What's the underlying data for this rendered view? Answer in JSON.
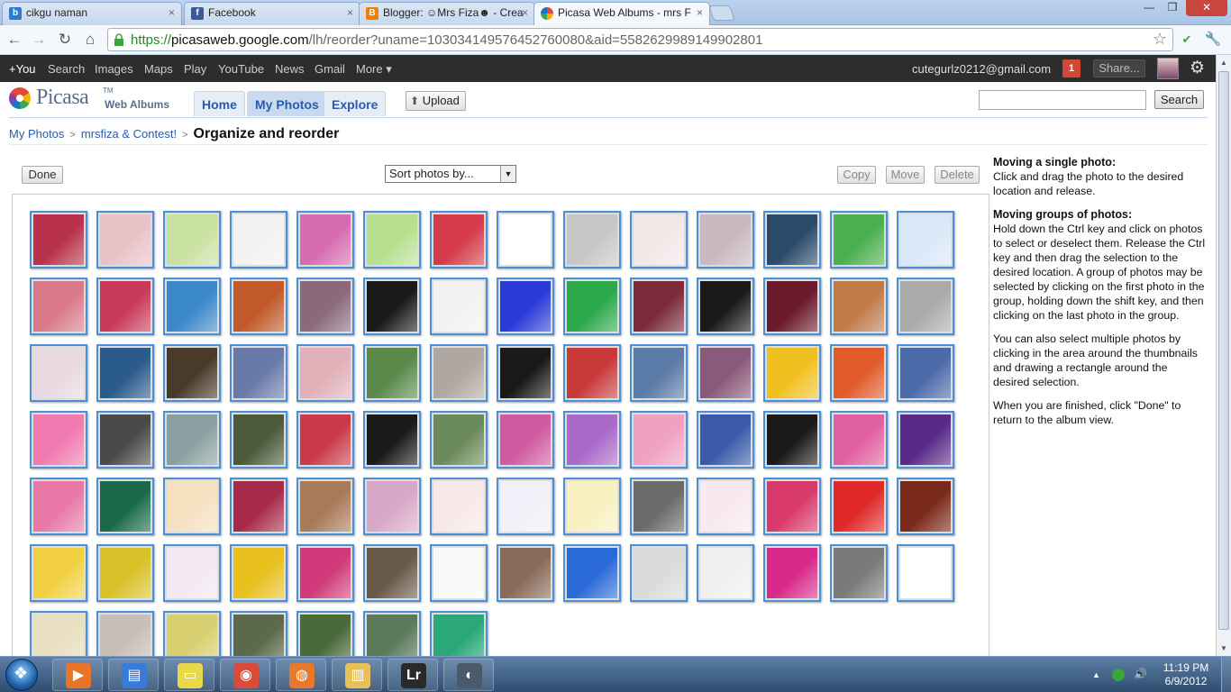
{
  "browser": {
    "tabs": [
      {
        "label": "cikgu naman",
        "active": false,
        "color": "#2d7bd1"
      },
      {
        "label": "Facebook",
        "active": false,
        "color": "#3b5998"
      },
      {
        "label": "Blogger: ☺Mrs Fiza☻ - Crea",
        "active": false,
        "color": "#f57d00"
      },
      {
        "label": "Picasa Web Albums - mrs F",
        "active": true,
        "color": "#9c4ea6"
      }
    ],
    "tab_close": "×",
    "window": {
      "minimize": "—",
      "maximize": "❐",
      "close": "✕"
    },
    "nav": {
      "back": "←",
      "forward": "→",
      "reload": "↻",
      "home": "⌂",
      "wrench": "🔧"
    },
    "url_scheme": "https://",
    "url_host": "picasaweb.google.com",
    "url_path": "/lh/reorder?uname=103034149576452760080&aid=5582629989149902801",
    "star": "☆"
  },
  "gbar": {
    "items": [
      "+You",
      "Search",
      "Images",
      "Maps",
      "Play",
      "YouTube",
      "News",
      "Gmail",
      "More ▾"
    ],
    "email": "cutegurlz0212@gmail.com",
    "notification_count": "1",
    "share_label": "Share...",
    "gear": "⚙"
  },
  "header": {
    "logo_name": "Picasa",
    "logo_tm": "TM",
    "logo_sub": "Web Albums",
    "tabs": [
      {
        "label": "Home",
        "active": false
      },
      {
        "label": "My Photos",
        "active": true
      },
      {
        "label": "Explore",
        "active": false
      }
    ],
    "upload_label": "Upload",
    "upload_icon": "⬆",
    "search_button": "Search",
    "search_value": ""
  },
  "breadcrumb": {
    "root": "My Photos",
    "album": "mrsfiza & Contest!",
    "sep": ">",
    "current": "Organize and reorder"
  },
  "controls": {
    "done": "Done",
    "sort_label": "Sort photos by...",
    "sort_arrow": "▼",
    "copy": "Copy",
    "move": "Move",
    "delete": "Delete"
  },
  "photos": {
    "row_counts": [
      14,
      14,
      14,
      14,
      14,
      14,
      7
    ],
    "colors": [
      [
        "#b8324a",
        "#e8c2c6",
        "#c8e0a0",
        "#f2f2f2",
        "#d56bb0",
        "#b6e08f",
        "#d43a4a",
        "#ffffff",
        "#c6c6c6",
        "#f2e8e8",
        "#c8b8c0",
        "#2a4a6a",
        "#4caf50",
        "#d9e8f8"
      ],
      [
        "#d87a8a",
        "#c83a5a",
        "#3a88c8",
        "#c05a2a",
        "#8a6a7a",
        "#1a1a1a",
        "#f2f2f2",
        "#2a3ad8",
        "#2aa84a",
        "#7a2a3a",
        "#1a1a1a",
        "#6a1a2a",
        "#c07a4a",
        "#aaaaaa"
      ],
      [
        "#e8d8e0",
        "#2a5a8a",
        "#4a3a2a",
        "#6a7aa8",
        "#e0b0b8",
        "#5a8a4a",
        "#b0a8a0",
        "#1a1a1a",
        "#c83a3a",
        "#5a7aa8",
        "#8a5a7a",
        "#f0c020",
        "#e05a2a",
        "#4a6aa8"
      ],
      [
        "#f07ab0",
        "#4a4a4a",
        "#8aa0a0",
        "#4a5a3a",
        "#c83a4a",
        "#1a1a1a",
        "#6a8a5a",
        "#d05aa0",
        "#a86ac8",
        "#f0a0c0",
        "#3a5aa8",
        "#1a1a1a",
        "#e060a0",
        "#5a2a8a"
      ],
      [
        "#e878a8",
        "#1a6a4a",
        "#f5e0c0",
        "#a82a4a",
        "#a87a5a",
        "#d8a8c8",
        "#f8e8e8",
        "#f0f0f8",
        "#f8f0c0",
        "#6a6a6a",
        "#f8e8f0",
        "#d83a6a",
        "#e02a2a",
        "#7a2a1a"
      ],
      [
        "#f0d040",
        "#d8c028",
        "#f2e8f0",
        "#e8c020",
        "#d03a7a",
        "#6a5a4a",
        "#f8f8f8",
        "#8a6a5a",
        "#2a6ad8",
        "#dadada",
        "#f0f0f0",
        "#d82a8a",
        "#7a7a7a",
        "#ffffff"
      ],
      [
        "#e8e0c0",
        "#c8c0b8",
        "#d8d070",
        "#5a6a4a",
        "#4a6a3a",
        "#5a7a5a",
        "#2aa878"
      ]
    ]
  },
  "help": {
    "h1": "Moving a single photo:",
    "p1": "Click and drag the photo to the desired location and release.",
    "h2": "Moving groups of photos:",
    "p2": "Hold down the Ctrl key and click on photos to select or deselect them. Release the Ctrl key and then drag the selection to the desired location. A group of photos may be selected by clicking on the first photo in the group, holding down the shift key, and then clicking on the last photo in the group.",
    "p3": "You can also select multiple photos by clicking in the area around the thumbnails and drawing a rectangle around the desired selection.",
    "p4": "When you are finished, click \"Done\" to return to the album view."
  },
  "scrollbar": {
    "up": "▲",
    "down": "▼"
  },
  "taskbar": {
    "apps": [
      {
        "name": "media-player",
        "glyph": "▶",
        "color": "#e8742a"
      },
      {
        "name": "notes",
        "glyph": "▤",
        "color": "#3a7ad8"
      },
      {
        "name": "sticky-notes",
        "glyph": "▭",
        "color": "#e8d84a"
      },
      {
        "name": "chrome",
        "glyph": "◉",
        "color": "#d84a3a"
      },
      {
        "name": "firefox",
        "glyph": "◍",
        "color": "#e8782a"
      },
      {
        "name": "explorer",
        "glyph": "▥",
        "color": "#e8c05a"
      },
      {
        "name": "lightroom",
        "glyph": "Lr",
        "color": "#2a2a2a"
      },
      {
        "name": "sync",
        "glyph": "◐",
        "color": "#4a5a6a"
      }
    ],
    "tray_arrow": "▲",
    "tray_speaker": "🔊",
    "time": "11:19 PM",
    "date": "6/9/2012"
  }
}
